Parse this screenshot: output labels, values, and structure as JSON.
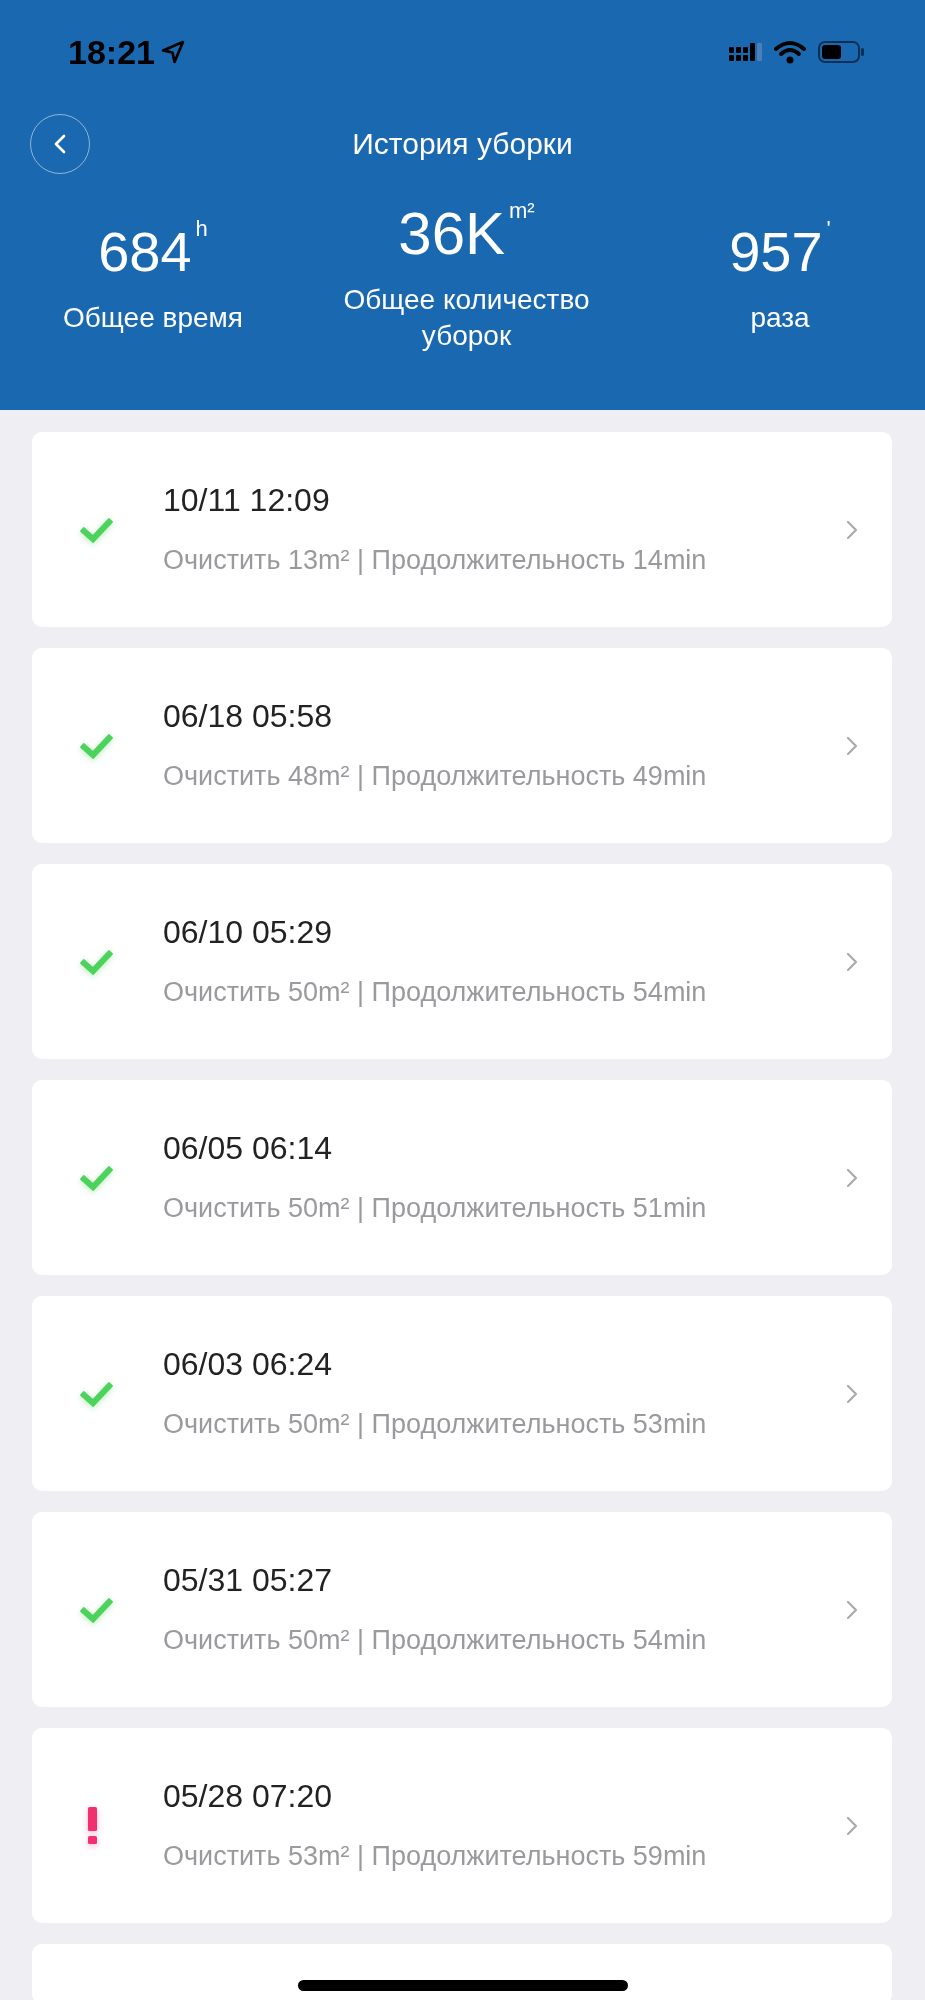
{
  "status_bar": {
    "time": "18:21"
  },
  "header": {
    "title": "История уборки"
  },
  "stats": [
    {
      "value": "684",
      "unit": "h",
      "label": "Общее время"
    },
    {
      "value": "36K",
      "unit": "m²",
      "label": "Общее количество уборок"
    },
    {
      "value": "957",
      "unit": "'",
      "label": "раза"
    }
  ],
  "records": [
    {
      "kind": "ok",
      "date": "10/11 12:09",
      "details": "Очистить 13m² | Продолжительность 14min"
    },
    {
      "kind": "ok",
      "date": "06/18 05:58",
      "details": "Очистить 48m² | Продолжительность 49min"
    },
    {
      "kind": "ok",
      "date": "06/10 05:29",
      "details": "Очистить 50m² | Продолжительность 54min"
    },
    {
      "kind": "ok",
      "date": "06/05 06:14",
      "details": "Очистить 50m² | Продолжительность 51min"
    },
    {
      "kind": "ok",
      "date": "06/03 06:24",
      "details": "Очистить 50m² | Продолжительность 53min"
    },
    {
      "kind": "ok",
      "date": "05/31 05:27",
      "details": "Очистить 50m² | Продолжительность 54min"
    },
    {
      "kind": "error",
      "date": "05/28 07:20",
      "details": "Очистить 53m² | Продолжительность 59min"
    }
  ]
}
